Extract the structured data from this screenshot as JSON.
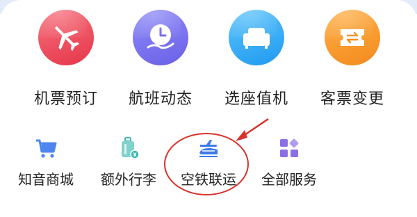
{
  "top_services": [
    {
      "label": "机票预订",
      "icon": "airplane-icon",
      "color": "#e8404f"
    },
    {
      "label": "航班动态",
      "icon": "clock-hand-icon",
      "color": "#6e63ea"
    },
    {
      "label": "选座值机",
      "icon": "seat-sofa-icon",
      "color": "#2aa0f2"
    },
    {
      "label": "客票变更",
      "icon": "ticket-exchange-icon",
      "color": "#f5901f"
    }
  ],
  "more_services": [
    {
      "label": "知音商城",
      "icon": "shopping-cart-icon",
      "color": "#4d86ee"
    },
    {
      "label": "额外行李",
      "icon": "luggage-icon",
      "color": "#3fb7b0"
    },
    {
      "label": "空铁联运",
      "icon": "plane-train-icon",
      "color": "#3e7be6"
    },
    {
      "label": "全部服务",
      "icon": "grid-apps-icon",
      "color": "#8b6fe4"
    }
  ],
  "annotation": {
    "color": "#d9312b",
    "highlighted": "空铁联运"
  }
}
